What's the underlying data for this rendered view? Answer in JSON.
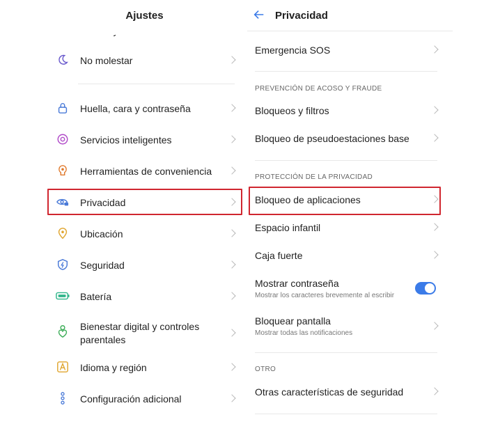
{
  "left": {
    "title": "Ajustes",
    "partial_item": "Sonido y vibración",
    "items": [
      {
        "label": "No molestar",
        "icon": "moon-icon"
      },
      {
        "label": "Huella, cara y contraseña",
        "icon": "lock-icon"
      },
      {
        "label": "Servicios inteligentes",
        "icon": "target-icon"
      },
      {
        "label": "Herramientas de conveniencia",
        "icon": "tools-icon"
      },
      {
        "label": "Privacidad",
        "icon": "privacy-eye-icon"
      },
      {
        "label": "Ubicación",
        "icon": "location-pin-icon"
      },
      {
        "label": "Seguridad",
        "icon": "shield-icon"
      },
      {
        "label": "Batería",
        "icon": "battery-icon"
      },
      {
        "label": "Bienestar digital y controles",
        "label2": "parentales",
        "icon": "wellbeing-icon"
      },
      {
        "label": "Idioma y región",
        "icon": "language-icon"
      },
      {
        "label": "Configuración adicional",
        "icon": "more-settings-icon"
      }
    ]
  },
  "right": {
    "title": "Privacidad",
    "emergency": "Emergencia SOS",
    "section1": "PREVENCIÓN DE ACOSO Y FRAUDE",
    "bloqueos": "Bloqueos y filtros",
    "pseudo": "Bloqueo de pseudoestaciones base",
    "section2": "PROTECCIÓN DE LA PRIVACIDAD",
    "app_lock": "Bloqueo de aplicaciones",
    "kid_space": "Espacio infantil",
    "safe": "Caja fuerte",
    "show_pw": "Mostrar contraseña",
    "show_pw_sub": "Mostrar los caracteres brevemente al escribir",
    "show_pw_on": true,
    "lock_screen": "Bloquear pantalla",
    "lock_screen_sub": "Mostrar todas las notificaciones",
    "section3": "OTRO",
    "other": "Otras características de seguridad"
  },
  "colors": {
    "accent": "#3b7be8",
    "highlight": "#d0262f"
  }
}
